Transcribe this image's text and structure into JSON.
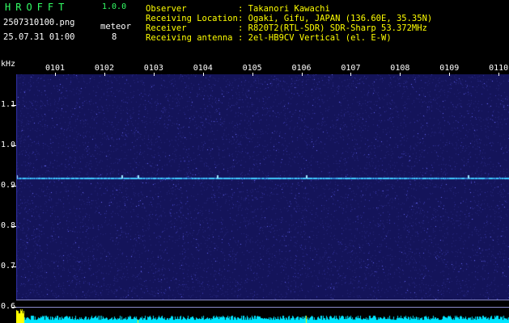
{
  "header": {
    "logo": "HROFFT",
    "version": "1.0.0",
    "filename": "2507310100.png",
    "datetime": "25.07.31 01:00",
    "meteor_label": "meteor",
    "meteor_count": "8"
  },
  "station_info": [
    {
      "key": "Observer",
      "value": ": Takanori Kawachi"
    },
    {
      "key": "Receiving Location",
      "value": ": Ogaki, Gifu, JAPAN (136.60E, 35.35N)"
    },
    {
      "key": "Receiver",
      "value": ": R820T2(RTL-SDR) SDR-Sharp 53.372MHz"
    },
    {
      "key": "Receiving antenna",
      "value": ": 2el-HB9CV Vertical (el. E-W)"
    }
  ],
  "chart_data": {
    "type": "heatmap",
    "ylabel": "kHz",
    "y_ticks": [
      "1.1",
      "1.0",
      "0.9",
      "0.8",
      "0.7",
      "0.6"
    ],
    "x_ticks": [
      "0101",
      "0102",
      "0103",
      "0104",
      "0105",
      "0106",
      "0107",
      "0108",
      "0109",
      "0110"
    ],
    "ylim": [
      0.6,
      1.1
    ],
    "signal_line_khz": 0.92,
    "colors": {
      "background": "#14145a",
      "signal": "#40c8ff",
      "noise": "#3a3ab0",
      "histogram": "#00e5ff",
      "histogram_peak": "#ffff00"
    }
  }
}
